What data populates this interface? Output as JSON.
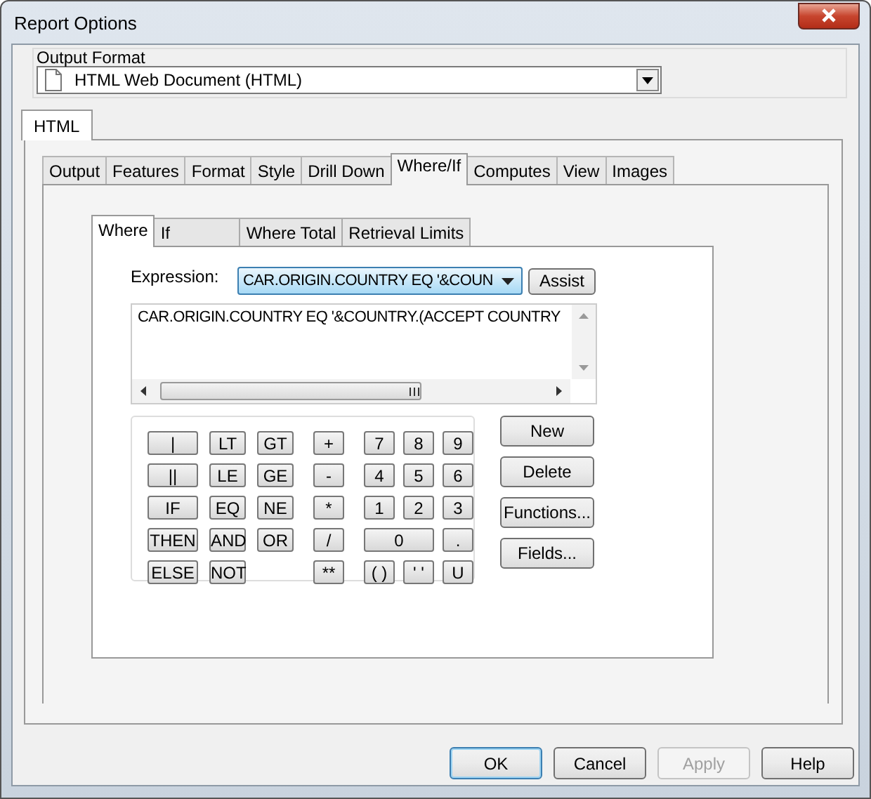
{
  "window": {
    "title": "Report Options"
  },
  "output_format": {
    "label": "Output Format",
    "value": "HTML Web Document (HTML)"
  },
  "format_tabs": [
    {
      "label": "HTML",
      "selected": true
    }
  ],
  "tabs": [
    {
      "label": "Output",
      "selected": false
    },
    {
      "label": "Features",
      "selected": false
    },
    {
      "label": "Format",
      "selected": false
    },
    {
      "label": "Style",
      "selected": false
    },
    {
      "label": "Drill Down",
      "selected": false
    },
    {
      "label": "Where/If",
      "selected": true
    },
    {
      "label": "Computes",
      "selected": false
    },
    {
      "label": "View",
      "selected": false
    },
    {
      "label": "Images",
      "selected": false
    }
  ],
  "sub_tabs": [
    {
      "label": "Where",
      "selected": true
    },
    {
      "label": "If",
      "selected": false
    },
    {
      "label": "Where Total",
      "selected": false
    },
    {
      "label": "Retrieval Limits",
      "selected": false
    }
  ],
  "expression": {
    "label": "Expression:",
    "value": "CAR.ORIGIN.COUNTRY EQ '&COUN",
    "assist": "Assist"
  },
  "editor": {
    "text": "CAR.ORIGIN.COUNTRY EQ '&COUNTRY.(ACCEPT COUNTRY"
  },
  "keypad": {
    "logic": [
      "|",
      "LT",
      "GT",
      "||",
      "LE",
      "GE",
      "IF",
      "EQ",
      "NE",
      "THEN",
      "AND",
      "OR",
      "ELSE",
      "NOT"
    ],
    "operators": [
      "+",
      "-",
      "*",
      "/",
      "**"
    ],
    "digits": [
      {
        "label": "7",
        "kind": "key"
      },
      {
        "label": "8",
        "kind": "key"
      },
      {
        "label": "9",
        "kind": "key"
      },
      {
        "label": "4",
        "kind": "key"
      },
      {
        "label": "5",
        "kind": "key"
      },
      {
        "label": "6",
        "kind": "key"
      },
      {
        "label": "1",
        "kind": "key"
      },
      {
        "label": "2",
        "kind": "key"
      },
      {
        "label": "3",
        "kind": "key"
      },
      {
        "label": "0",
        "kind": "wide"
      },
      {
        "label": ".",
        "kind": "key"
      },
      {
        "label": "( )",
        "kind": "key"
      },
      {
        "label": "' '",
        "kind": "key"
      },
      {
        "label": "U",
        "kind": "key"
      }
    ]
  },
  "side_buttons": [
    "New",
    "Delete",
    "Functions...",
    "Fields..."
  ],
  "buttons": [
    {
      "label": "OK",
      "default": true,
      "disabled": false
    },
    {
      "label": "Cancel",
      "default": false,
      "disabled": false
    },
    {
      "label": "Apply",
      "default": false,
      "disabled": true
    },
    {
      "label": "Help",
      "default": false,
      "disabled": false
    }
  ]
}
